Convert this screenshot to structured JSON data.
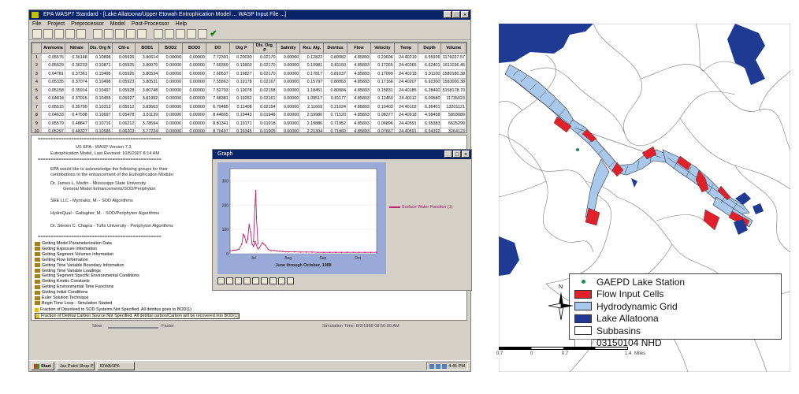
{
  "app": {
    "title": "EPA WASP7 Standard - [Lake Allatoona/Upper Etowah Entrophication Model ... WASP Input File ...]",
    "menu": [
      "File",
      "Project",
      "Preprocessor",
      "Model",
      "Post-Processor",
      "Help"
    ],
    "toolbar_icons": [
      "new-icon",
      "open-icon",
      "save-icon",
      "delete-icon",
      "print-icon",
      "cut-icon",
      "copy-icon",
      "paste-icon",
      "preview-icon",
      "edit-icon",
      "kinetics-icon",
      "run-icon",
      "graph-icon",
      "export-icon",
      "settings-icon",
      "check-icon"
    ]
  },
  "grid": {
    "columns": [
      "Ammonia",
      "Nitrate",
      "Dis. Org N",
      "Chl-a",
      "BOD1",
      "BOD2",
      "BOD3",
      "DO",
      "Org P",
      "Dis. Org. P",
      "Salinity",
      "Res. Alg.",
      "Detritus",
      "Flow",
      "Velocity",
      "Temp",
      "Depth",
      "Volume"
    ],
    "rows": [
      {
        "n": "1",
        "v": [
          "0.05576",
          "0.36148",
          "0.10898",
          "0.05926",
          "3.80614",
          "0.00000",
          "0.00000",
          "7.72391",
          "0.20030",
          "0.02170",
          "0.00000",
          "0.12822",
          "0.80982",
          "4.85893",
          "0.23606",
          "24.40219",
          "6.55926",
          "1176027.57"
        ]
      },
      {
        "n": "2",
        "v": [
          "0.05529",
          "0.36233",
          "0.10871",
          "0.05925",
          "3.80075",
          "0.00000",
          "0.00000",
          "7.69359",
          "0.19903",
          "0.02170",
          "0.00000",
          "0.10981",
          "0.81150",
          "4.85893",
          "0.17265",
          "24.40265",
          "6.62401",
          "1611036.45"
        ]
      },
      {
        "n": "3",
        "v": [
          "0.04781",
          "0.37361",
          "0.10495",
          "0.05926",
          "3.80534",
          "0.00000",
          "0.00000",
          "7.60537",
          "0.19827",
          "0.02170",
          "0.00000",
          "0.17817",
          "0.81037",
          "4.85893",
          "0.17099",
          "24.40218",
          "5.91100",
          "1580180.38"
        ]
      },
      {
        "n": "4",
        "v": [
          "0.05335",
          "0.37074",
          "0.10498",
          "0.05923",
          "3.80531",
          "0.00000",
          "0.00000",
          "7.55863",
          "0.19178",
          "0.02167",
          "0.00000",
          "0.15797",
          "0.80953",
          "4.85893",
          "0.17166",
          "24.40207",
          "6.92300",
          "1583000.38"
        ]
      },
      {
        "n": "5",
        "v": [
          "0.05158",
          "0.35914",
          "0.10497",
          "0.05928",
          "3.80748",
          "0.00000",
          "0.00000",
          "7.52793",
          "0.19078",
          "0.02158",
          "0.00000",
          "1.18451",
          "0.80984",
          "4.85893",
          "0.15831",
          "24.40185",
          "6.28460",
          "5158178.70"
        ]
      },
      {
        "n": "6",
        "v": [
          "0.04818",
          "0.37015",
          "0.10455",
          "0.05927",
          "3.81992",
          "0.00000",
          "0.00000",
          "7.48381",
          "0.19262",
          "0.02161",
          "0.00000",
          "1.09517",
          "0.81177",
          "4.85893",
          "0.12460",
          "24.40112",
          "6.09580",
          "11735023"
        ]
      },
      {
        "n": "7",
        "v": [
          "0.05515",
          "0.35709",
          "0.10313",
          "0.05512",
          "3.83663",
          "0.00000",
          "0.00000",
          "6.79485",
          "0.11408",
          "0.02154",
          "0.00000",
          "2.11669",
          "0.21024",
          "4.85893",
          "0.10403",
          "24.40102",
          "6.36401",
          "13201121"
        ]
      },
      {
        "n": "8",
        "v": [
          "0.04633",
          "0.47508",
          "0.10697",
          "0.05478",
          "3.81139",
          "0.00000",
          "0.00000",
          "8.44805",
          "0.19443",
          "0.01948",
          "0.00000",
          "2.59980",
          "0.71520",
          "4.85893",
          "0.08377",
          "24.40918",
          "4.58458",
          "5893089"
        ]
      },
      {
        "n": "9",
        "v": [
          "0.05579",
          "0.48847",
          "0.10716",
          "0.06212",
          "3.78594",
          "0.00000",
          "0.00000",
          "8.81341",
          "0.19171",
          "0.01918",
          "0.00000",
          "2.19886",
          "0.71952",
          "4.85893",
          "0.06896",
          "24.40591",
          "6.55383",
          "6625299"
        ]
      },
      {
        "n": "10",
        "v": [
          "0.05297",
          "0.48327",
          "0.10585",
          "0.06203",
          "3.77224",
          "0.00000",
          "0.00000",
          "8.70497",
          "0.19345",
          "0.01905",
          "0.00000",
          "2.21304",
          "0.71960",
          "4.85893",
          "0.07667",
          "24.40591",
          "6.54392",
          "3264123"
        ]
      }
    ]
  },
  "log": {
    "header_lines": [
      "US EPA - WASP Version 7.3",
      "Eutrophication Model, Last Revised: 10/5/2007 8:14 AM"
    ],
    "ack_lines": [
      "EPA would like to acknowledge the following groups for their",
      "contributions to the enhancement of the Eutrophication Module:"
    ],
    "credits": [
      "Dr. James L. Martin - Mississippi State University",
      "General Model Enhancements/SOD/Periphyton",
      "SEE LLC - Myrtrakis, M. - SOD Algorithms",
      "HydroQual - Gallagher, M. - SOD/Periphyton Algorithms",
      "Dr. Steven C. Chapra - Tufts University - Periphyton Algorithms"
    ],
    "separator": "================================================",
    "tasks": [
      "Getting Model Parameterization Data",
      "Getting Exposure Information",
      "Getting Segment Volumes Information",
      "Getting Flow Information",
      "Getting Time Variable Boundary Information",
      "Getting Time Variable Loadings",
      "Getting Segment Specific Environmental Conditions",
      "Getting Kinetic Constants",
      "Getting Environmental Time Functions",
      "Getting Initial Conditions",
      "Euler Solution Technique",
      "Begin Time Loop - Simulation Started"
    ],
    "warnings": [
      "Fraction of Dissolved to SOD Systems Not Specified. All detritus goes to BOD(1)",
      "Fraction of Detrital Carbon Source Not Specified. All detrital carbon/Carbon will be recovered into BOD(1)"
    ]
  },
  "graph": {
    "title": "Graph",
    "legend": "Surface Water Function (1)",
    "xlabel": "June through October, 1988",
    "tools": [
      "zoom-in-icon",
      "zoom-out-icon",
      "pan-icon",
      "scale-icon",
      "grid-icon",
      "print-icon",
      "copy-icon",
      "find-icon",
      "reset-icon"
    ]
  },
  "chart_data": {
    "type": "line",
    "title": "Graph",
    "xlabel": "June through October, 1988",
    "ylabel": "",
    "categories": [
      "Jul",
      "Aug",
      "Sep",
      "Oct"
    ],
    "ytick_labels": [
      "0",
      "100",
      "200",
      "300"
    ],
    "ylim": [
      0,
      350
    ],
    "series": [
      {
        "name": "Surface Water Function (1)",
        "x": [
          0,
          2,
          4,
          6,
          8,
          9,
          10,
          11,
          12,
          13,
          14,
          15,
          16,
          17,
          18,
          19,
          20,
          22,
          24,
          26,
          28,
          30,
          32,
          34,
          36,
          38,
          40,
          44,
          48,
          52,
          56,
          60,
          64,
          68,
          72,
          76,
          80,
          84,
          88,
          92,
          96,
          100
        ],
        "y": [
          12,
          14,
          15,
          18,
          40,
          80,
          70,
          45,
          60,
          120,
          90,
          40,
          30,
          50,
          35,
          20,
          25,
          45,
          35,
          18,
          12,
          14,
          11,
          10,
          9,
          8,
          8,
          8,
          7,
          7,
          7,
          6,
          6,
          6,
          6,
          6,
          6,
          6,
          6,
          6,
          6,
          6
        ]
      },
      {
        "name": "",
        "x": [
          16,
          17,
          17.5,
          18,
          19
        ],
        "y": [
          50,
          200,
          260,
          150,
          40
        ]
      }
    ]
  },
  "speed": {
    "slow": "Slow",
    "fast": "Faster",
    "sim_time": "Simulation Time: 8/2/1988 08:50:00 AM"
  },
  "taskbar": {
    "start": "Start",
    "tasks": [
      "Jaz Paint Shop Pro",
      "IDWASP6"
    ],
    "clock": "4:45 PM"
  },
  "map": {
    "legend": [
      {
        "label": "GAEPD Lake Station",
        "swatch": "dot",
        "color": "#2a8a4a"
      },
      {
        "label": "Flow Input Cells",
        "swatch": "fill",
        "color": "#e0202a"
      },
      {
        "label": "Hydrodynamic Grid",
        "swatch": "fill",
        "color": "#a8c8ec"
      },
      {
        "label": "Lake Allatoona",
        "swatch": "fill",
        "color": "#1f3a93"
      },
      {
        "label": "Subbasins",
        "swatch": "fill",
        "color": "#ffffff"
      },
      {
        "label": "03150104 NHD",
        "swatch": "line",
        "color": "#888888"
      }
    ],
    "north": "N",
    "scale_labels": [
      "0.7",
      "0",
      "0.7",
      "1.4",
      "Miles"
    ],
    "colors": {
      "water": "#1f3a93",
      "grid": "#a8c8ec",
      "input": "#e0202a",
      "boundary": "#777777"
    }
  }
}
